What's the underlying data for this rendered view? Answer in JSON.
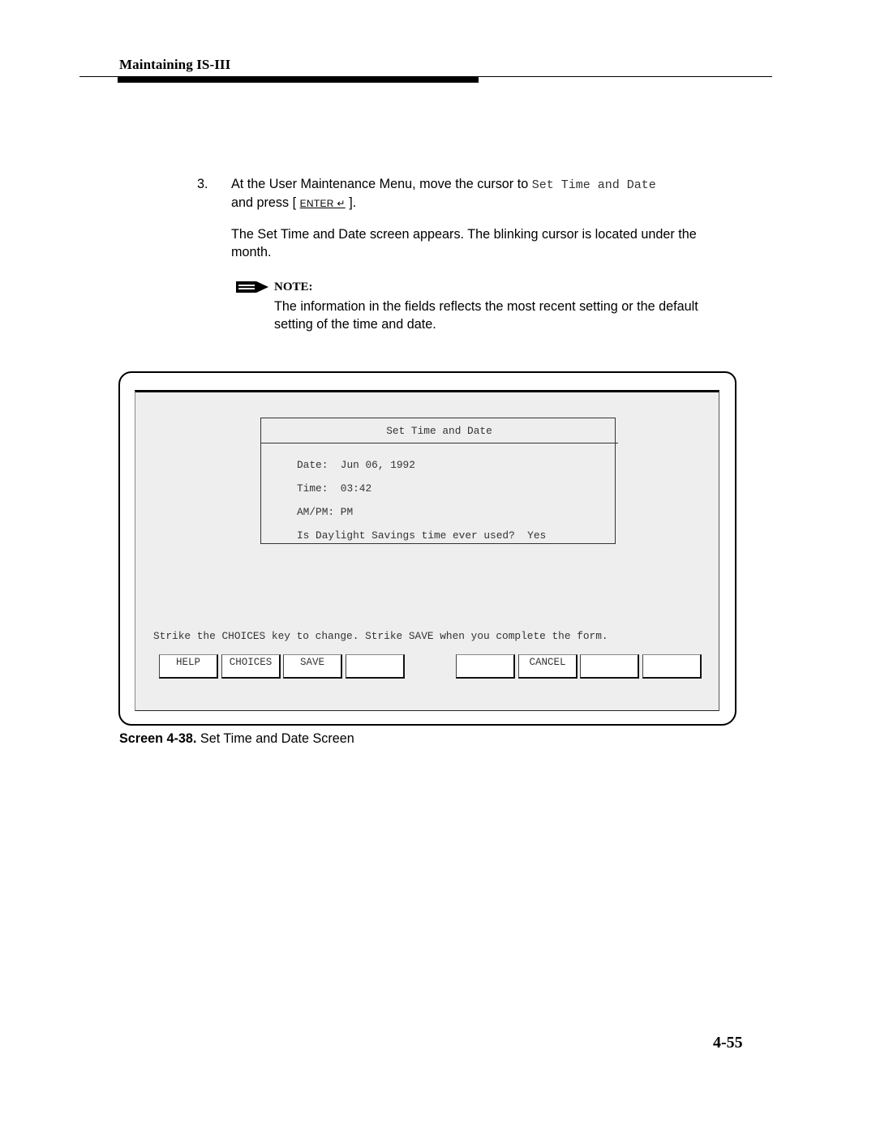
{
  "header": {
    "running_head": "Maintaining IS-III"
  },
  "step": {
    "number": "3.",
    "text_before_code": "At the User Maintenance Menu, move the cursor to ",
    "code": "Set Time and Date",
    "text_and_press": "and press [ ",
    "key_label": "ENTER",
    "key_symbol": "↵",
    "text_after_key": " ]."
  },
  "paragraph": "The Set Time and Date screen appears. The blinking cursor is located under the month.",
  "note": {
    "icon": "pointing-arrow-icon",
    "label": "NOTE:",
    "text": "The information in the fields reflects the most recent setting or the default setting of the time and date."
  },
  "screen": {
    "form_title": "Set Time and Date",
    "fields": {
      "date_label": "Date:",
      "date_value": "Jun 06, 1992",
      "time_label": "Time:",
      "time_value": "03:42",
      "ampm_label": "AM/PM:",
      "ampm_value": "PM",
      "dst_label": "Is Daylight Savings time ever used?",
      "dst_value": "Yes"
    },
    "instruction": "Strike the CHOICES key to change. Strike SAVE when you complete the form.",
    "function_keys": [
      "HELP",
      "CHOICES",
      "SAVE",
      "",
      "",
      "CANCEL",
      "",
      ""
    ]
  },
  "caption": {
    "label": "Screen 4-38.",
    "text": "Set Time and Date Screen"
  },
  "page_number": "4-55"
}
